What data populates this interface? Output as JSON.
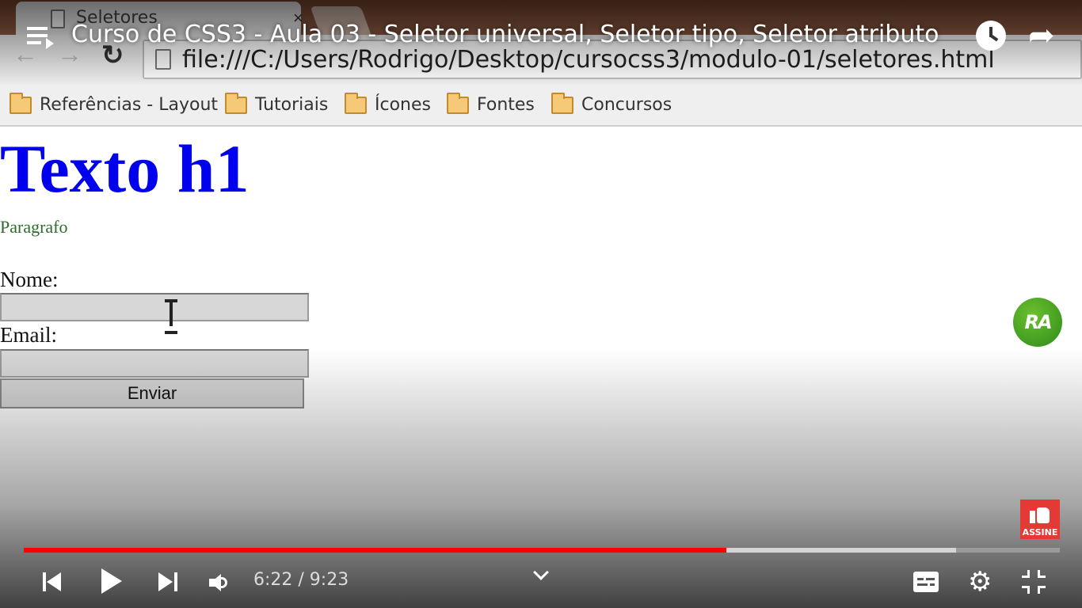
{
  "player": {
    "video_title": "Curso de CSS3 - Aula 03 - Seletor universal, Seletor tipo, Seletor atributo",
    "current_time": "6:22",
    "duration": "9:23",
    "time_display": "6:22 / 9:23",
    "progress_fraction": 0.678,
    "buffered_fraction": 0.9,
    "accent_color": "#ff0000",
    "icons": [
      "playlist-icon",
      "watch-later-icon",
      "share-icon",
      "previous-icon",
      "play-icon",
      "next-icon",
      "volume-icon",
      "chevron-down-icon",
      "captions-icon",
      "gear-icon",
      "exit-fullscreen-icon"
    ]
  },
  "channel_badge": {
    "text": "RA",
    "color": "#3c9e22"
  },
  "subscribe_badge": {
    "label": "ASSINE",
    "color": "#e53935"
  },
  "browser": {
    "tab_title": "Seletores",
    "tab_close": "×",
    "url": "file:///C:/Users/Rodrigo/Desktop/cursocss3/modulo-01/seletores.html",
    "bookmarks": [
      {
        "label": "Referências - Layout"
      },
      {
        "label": "Tutoriais"
      },
      {
        "label": "Ícones"
      },
      {
        "label": "Fontes"
      },
      {
        "label": "Concursos"
      }
    ]
  },
  "webpage": {
    "heading": "Texto h1",
    "heading_color": "#0000ee",
    "paragraph": "Paragrafo",
    "paragraph_color": "#2e6b2e",
    "name_label": "Nome:",
    "email_label": "Email:",
    "submit_label": "Enviar"
  }
}
